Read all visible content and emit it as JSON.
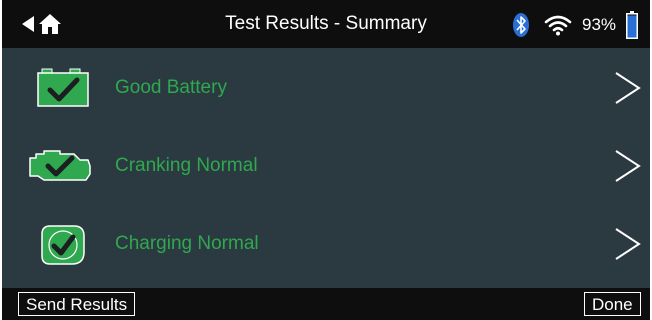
{
  "header": {
    "title": "Test Results - Summary",
    "battery_percent": "93%"
  },
  "results": [
    {
      "label": "Good Battery",
      "icon": "battery-check-icon"
    },
    {
      "label": "Cranking Normal",
      "icon": "engine-check-icon"
    },
    {
      "label": "Charging Normal",
      "icon": "alternator-check-icon"
    }
  ],
  "footer": {
    "send_label": "Send Results",
    "done_label": "Done"
  },
  "colors": {
    "accent_green": "#2fa84f",
    "background": "#2b3a40",
    "bar": "#0e0e0e"
  }
}
